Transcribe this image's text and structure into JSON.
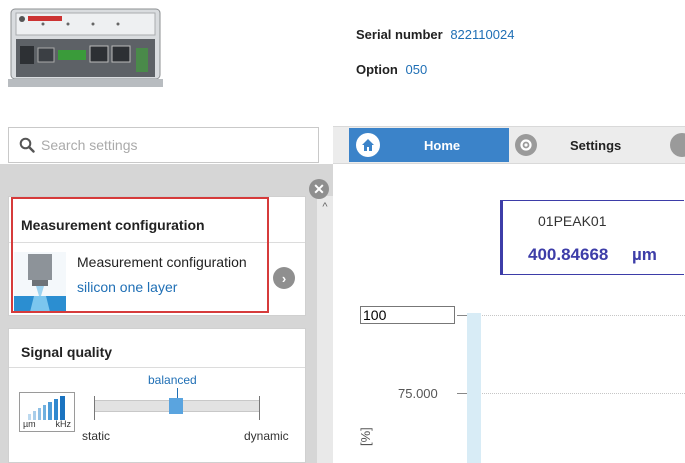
{
  "header": {
    "serial_label": "Serial number",
    "serial_value": "822110024",
    "option_label": "Option",
    "option_value": "050"
  },
  "search": {
    "placeholder": "Search settings"
  },
  "nav": {
    "tabs": [
      {
        "label": "Home",
        "icon": "home-icon",
        "active": true
      },
      {
        "label": "Settings",
        "icon": "gear-icon",
        "active": false
      }
    ]
  },
  "sidebar": {
    "measurement_config": {
      "title": "Measurement configuration",
      "item_label": "Measurement configuration",
      "item_value": "silicon one layer"
    },
    "signal_quality": {
      "title": "Signal quality",
      "unit_left": "µm",
      "unit_right": "kHz",
      "selected": "balanced",
      "min_label": "static",
      "max_label": "dynamic",
      "level": 0.5
    }
  },
  "measurement": {
    "name": "01PEAK01",
    "value": "400.84668",
    "unit": "µm"
  },
  "chart": {
    "ymax": "100",
    "tick_75": "75.000",
    "y_unit": "[%]"
  },
  "colors": {
    "accent": "#3b83c9",
    "value_color": "#3d3da8",
    "highlight": "#d63b3b"
  }
}
